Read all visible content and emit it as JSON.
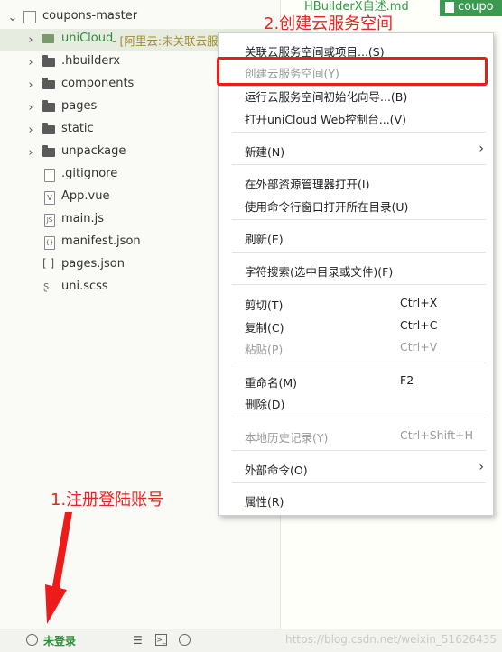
{
  "project": {
    "root": "coupons-master",
    "items": [
      {
        "label": "uniCloud",
        "suffix": " - [阿里云:未关联云服务",
        "type": "folder"
      },
      {
        "label": ".hbuilderx",
        "type": "folder"
      },
      {
        "label": "components",
        "type": "folder"
      },
      {
        "label": "pages",
        "type": "folder"
      },
      {
        "label": "static",
        "type": "folder"
      },
      {
        "label": "unpackage",
        "type": "folder"
      },
      {
        "label": ".gitignore",
        "type": "file"
      },
      {
        "label": "App.vue",
        "type": "vue"
      },
      {
        "label": "main.js",
        "type": "js"
      },
      {
        "label": "manifest.json",
        "type": "json"
      },
      {
        "label": "pages.json",
        "type": "brackets"
      },
      {
        "label": "uni.scss",
        "type": "scss"
      }
    ]
  },
  "tabs": {
    "inactive": "HBuilderX自述.md",
    "active": "coupo"
  },
  "menu": {
    "items": [
      {
        "label": "关联云服务空间或项目...(S)",
        "disabled": false
      },
      {
        "label": "创建云服务空间(Y)",
        "disabled": true
      },
      {
        "label": "运行云服务空间初始化向导...(B)",
        "disabled": false
      },
      {
        "label": "打开uniCloud Web控制台...(V)",
        "disabled": false
      },
      {
        "label": "新建(N)",
        "disabled": false,
        "submenu": true
      },
      {
        "label": "在外部资源管理器打开(I)",
        "disabled": false
      },
      {
        "label": "使用命令行窗口打开所在目录(U)",
        "disabled": false
      },
      {
        "label": "刷新(E)",
        "disabled": false
      },
      {
        "label": "字符搜索(选中目录或文件)(F)",
        "disabled": false
      },
      {
        "label": "剪切(T)",
        "shortcut": "Ctrl+X",
        "disabled": false
      },
      {
        "label": "复制(C)",
        "shortcut": "Ctrl+C",
        "disabled": false
      },
      {
        "label": "粘贴(P)",
        "shortcut": "Ctrl+V",
        "disabled": true
      },
      {
        "label": "重命名(M)",
        "shortcut": "F2",
        "disabled": false
      },
      {
        "label": "删除(D)",
        "disabled": false
      },
      {
        "label": "本地历史记录(Y)",
        "shortcut": "Ctrl+Shift+H",
        "disabled": true
      },
      {
        "label": "外部命令(O)",
        "disabled": false,
        "submenu": true
      },
      {
        "label": "属性(R)",
        "disabled": false
      }
    ]
  },
  "annotations": {
    "step1": "1.注册登陆账号",
    "step2": "2.创建云服务空间",
    "color": "#ee2222"
  },
  "status": {
    "login": "未登录",
    "watermark": "https://blog.csdn.net/weixin_51626435"
  },
  "colors": {
    "accent": "#3a9a4f",
    "selected_row": "#e6ecdf"
  }
}
